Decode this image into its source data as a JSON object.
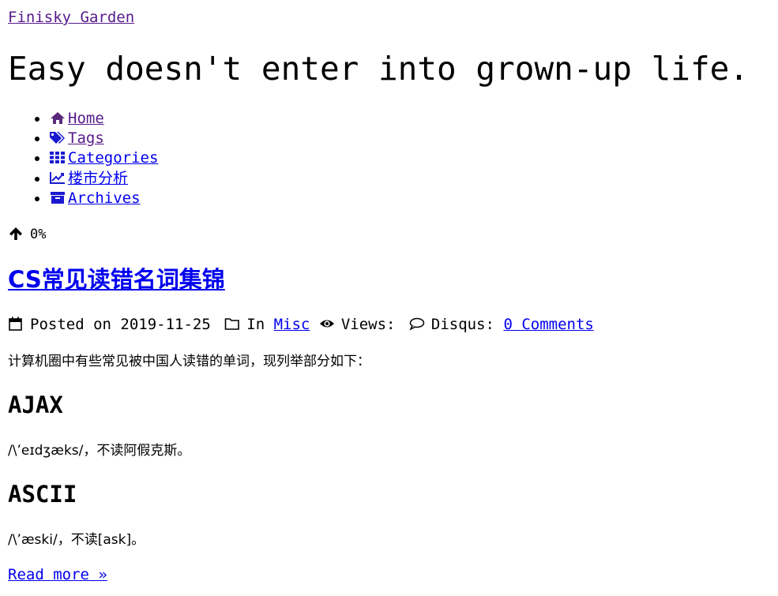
{
  "site": {
    "name": "Finisky Garden",
    "subtitle": "Easy doesn't enter into grown-up life."
  },
  "menu": {
    "items": [
      {
        "label": "Home",
        "icon": "home-icon"
      },
      {
        "label": "Tags",
        "icon": "tags-icon"
      },
      {
        "label": "Categories",
        "icon": "grid-icon"
      },
      {
        "label": "楼市分析",
        "icon": "line-chart-icon"
      },
      {
        "label": "Archives",
        "icon": "archive-icon"
      }
    ]
  },
  "progress": {
    "icon": "arrow-up-icon",
    "value": "0%"
  },
  "post": {
    "title": "CS常见读错名词集锦",
    "meta": {
      "posted_label": "Posted on",
      "date": "2019-11-25",
      "in_label": "In",
      "category": "Misc",
      "views_label": "Views:",
      "disqus_label": "Disqus:",
      "comments": "0 Comments"
    },
    "intro": "计算机圈中有些常见被中国人读错的单词，现列举部分如下：",
    "sections": [
      {
        "heading": "AJAX",
        "text": "/\\’eɪdʒæks/，不读阿假克斯。"
      },
      {
        "heading": "ASCII",
        "text": "/\\’æski/，不读[ask]。"
      }
    ],
    "read_more": "Read more »"
  },
  "colors": {
    "link": "#0000ee",
    "visited": "#551a8b",
    "text": "#000000"
  }
}
